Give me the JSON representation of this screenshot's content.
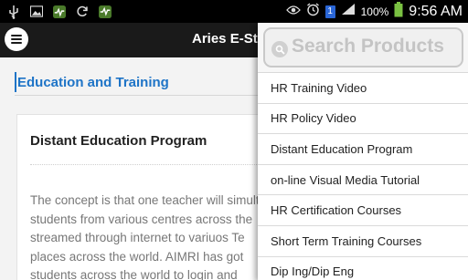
{
  "status_bar": {
    "icons_left": [
      "usb-icon",
      "gallery-icon",
      "activity-icon",
      "sync-icon",
      "activity-full-icon"
    ],
    "icons_right": [
      "eye-icon",
      "alarm-icon",
      "sim-icon",
      "signal-icon",
      "battery-icon"
    ],
    "sim_label": "1",
    "signal_label": "",
    "battery_text": "100%",
    "time": "9:56 AM"
  },
  "appbar": {
    "title": "Aries E-Store"
  },
  "section": {
    "title": "Education and Training"
  },
  "card": {
    "title": "Distant Education Program",
    "body_lines": [
      "The concept is that one teacher will simultaneously",
      "students from various centres across the",
      "streamed through internet to variuos Te",
      "places across the world. AIMRI has got",
      "students across the world to login and"
    ]
  },
  "search": {
    "placeholder": "Search Products"
  },
  "dropdown": {
    "items": [
      "HR Training Video",
      "HR Policy Video",
      "Distant Education Program",
      "on-line Visual Media Tutorial",
      "HR Certification Courses",
      "Short Term Training Courses",
      "Dip Ing/Dip Eng"
    ]
  },
  "colors": {
    "accent": "#1e74c7",
    "appbar": "#1a1a1a",
    "statusbar": "#000000",
    "battery": "#7ac142"
  }
}
